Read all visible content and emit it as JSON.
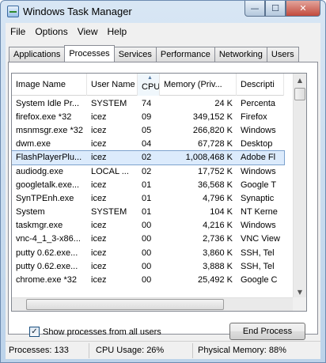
{
  "window": {
    "title": "Windows Task Manager",
    "min_glyph": "—",
    "max_glyph": "☐",
    "close_glyph": "✕"
  },
  "menu": [
    "File",
    "Options",
    "View",
    "Help"
  ],
  "tabs": [
    "Applications",
    "Processes",
    "Services",
    "Performance",
    "Networking",
    "Users"
  ],
  "active_tab": "Processes",
  "columns": [
    "Image Name",
    "User Name",
    "CPU",
    "Memory (Priv...",
    "Descripti"
  ],
  "sort_glyph": "▲",
  "processes": [
    {
      "name": "System Idle Pr...",
      "user": "SYSTEM",
      "cpu": "74",
      "mem": "24 K",
      "desc": "Percenta"
    },
    {
      "name": "firefox.exe *32",
      "user": "icez",
      "cpu": "09",
      "mem": "349,152 K",
      "desc": "Firefox"
    },
    {
      "name": "msnmsgr.exe *32",
      "user": "icez",
      "cpu": "05",
      "mem": "266,820 K",
      "desc": "Windows"
    },
    {
      "name": "dwm.exe",
      "user": "icez",
      "cpu": "04",
      "mem": "67,728 K",
      "desc": "Desktop"
    },
    {
      "name": "FlashPlayerPlu...",
      "user": "icez",
      "cpu": "02",
      "mem": "1,008,468 K",
      "desc": "Adobe Fl"
    },
    {
      "name": "audiodg.exe",
      "user": "LOCAL ...",
      "cpu": "02",
      "mem": "17,752 K",
      "desc": "Windows"
    },
    {
      "name": "googletalk.exe...",
      "user": "icez",
      "cpu": "01",
      "mem": "36,568 K",
      "desc": "Google T"
    },
    {
      "name": "SynTPEnh.exe",
      "user": "icez",
      "cpu": "01",
      "mem": "4,796 K",
      "desc": "Synaptic"
    },
    {
      "name": "System",
      "user": "SYSTEM",
      "cpu": "01",
      "mem": "104 K",
      "desc": "NT Kerne"
    },
    {
      "name": "taskmgr.exe",
      "user": "icez",
      "cpu": "00",
      "mem": "4,216 K",
      "desc": "Windows"
    },
    {
      "name": "vnc-4_1_3-x86...",
      "user": "icez",
      "cpu": "00",
      "mem": "2,736 K",
      "desc": "VNC View"
    },
    {
      "name": "putty 0.62.exe...",
      "user": "icez",
      "cpu": "00",
      "mem": "3,860 K",
      "desc": "SSH, Tel"
    },
    {
      "name": "putty 0.62.exe...",
      "user": "icez",
      "cpu": "00",
      "mem": "3,888 K",
      "desc": "SSH, Tel"
    },
    {
      "name": "chrome.exe *32",
      "user": "icez",
      "cpu": "00",
      "mem": "25,492 K",
      "desc": "Google C"
    }
  ],
  "selected_row": 4,
  "scroll_up_glyph": "▲",
  "scroll_down_glyph": "▼",
  "show_all_label": "Show processes from all users",
  "show_all_checked": true,
  "check_glyph": "✓",
  "end_process_label": "End Process",
  "status": {
    "processes": "Processes: 133",
    "cpu": "CPU Usage: 26%",
    "memory": "Physical Memory: 88%"
  }
}
